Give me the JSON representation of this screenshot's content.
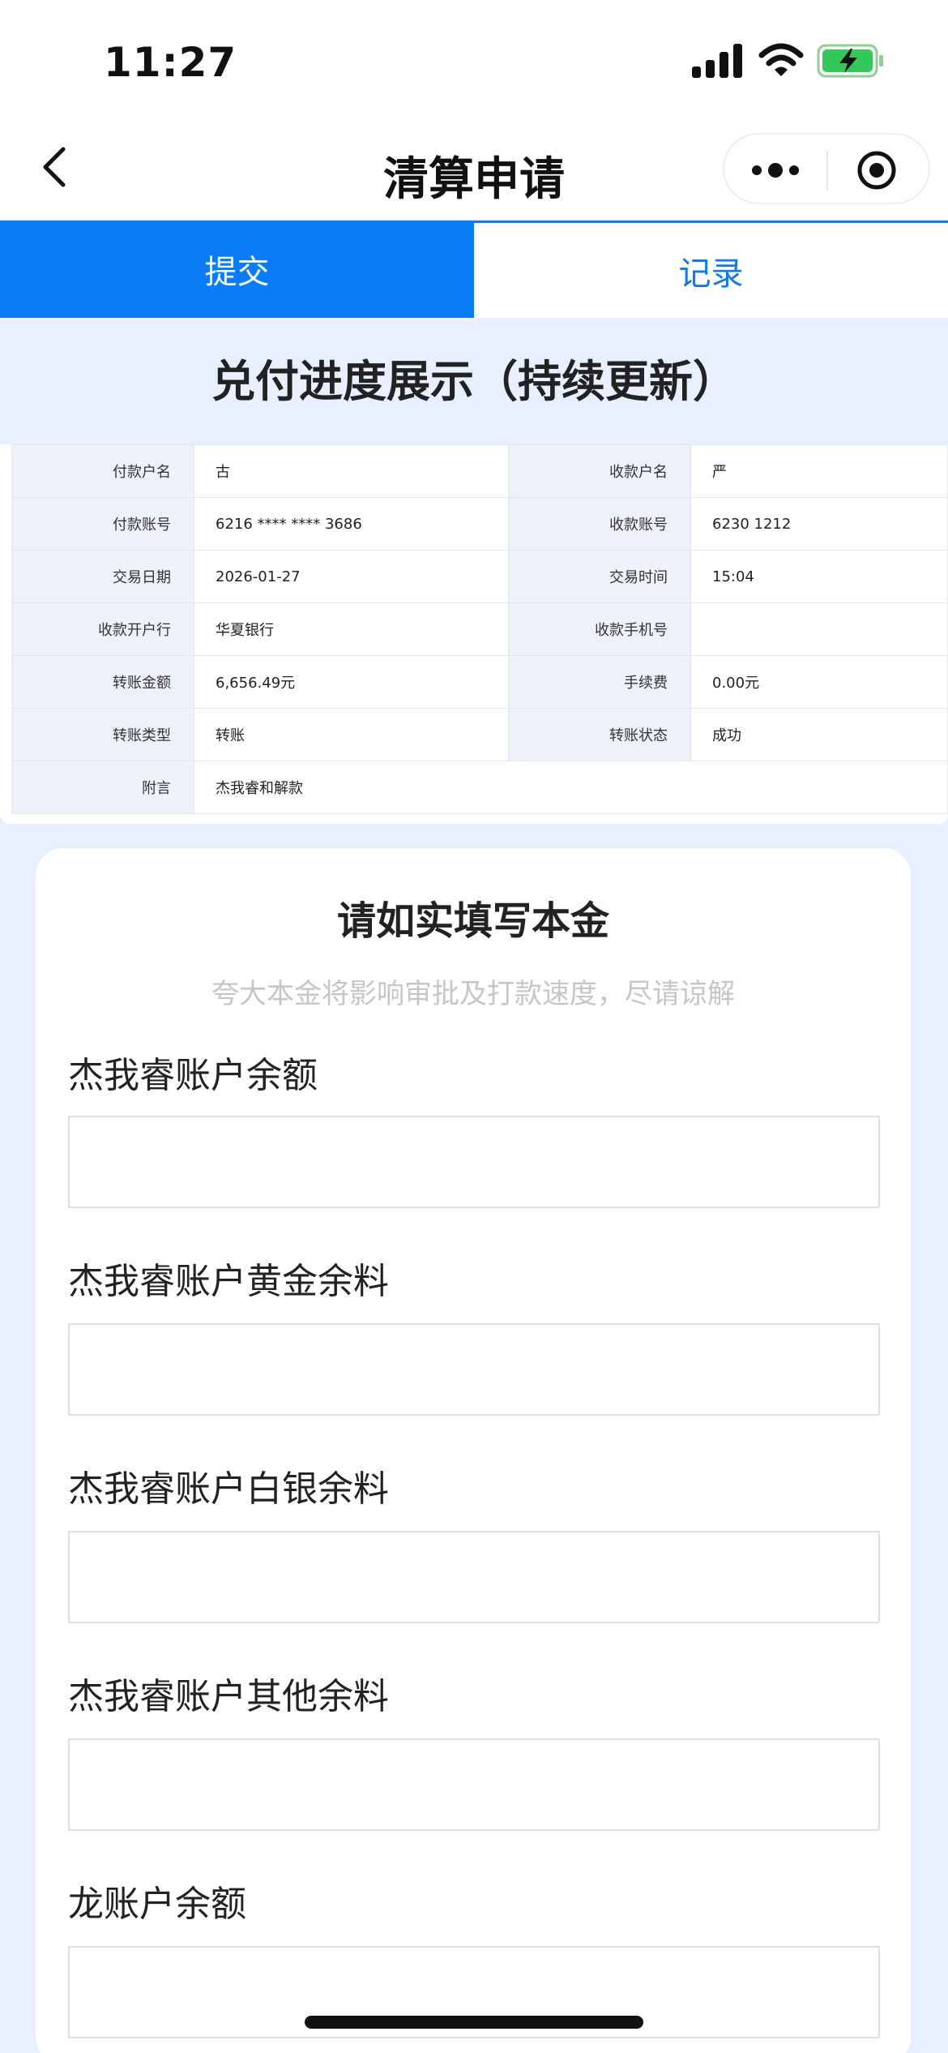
{
  "status_bar": {
    "time": "11:27",
    "icons": [
      "signal-icon",
      "wifi-icon",
      "battery-charging-icon"
    ],
    "battery_color": "#34c759"
  },
  "nav": {
    "title": "清算申请",
    "icons": [
      "back-icon",
      "more-icon",
      "target-icon"
    ]
  },
  "tabs": [
    {
      "label": "提交",
      "active": true
    },
    {
      "label": "记录",
      "active": false
    }
  ],
  "colors": {
    "accent": "#0a7cf6",
    "page_bg": "#e8efff",
    "placeholder": "#c6c6c6"
  },
  "section_title": "兑付进度展示（持续更新）",
  "receipt": {
    "rows": [
      {
        "l1": "付款户名",
        "v1": "古",
        "l2": "收款户名",
        "v2": "严"
      },
      {
        "l1": "付款账号",
        "v1": "6216 **** **** 3686",
        "l2": "收款账号",
        "v2": "6230 1212"
      },
      {
        "l1": "交易日期",
        "v1": "2026-01-27",
        "l2": "交易时间",
        "v2": "15:04"
      },
      {
        "l1": "收款开户行",
        "v1": "华夏银行",
        "l2": "收款手机号",
        "v2": ""
      },
      {
        "l1": "转账金额",
        "v1": "6,656.49元",
        "l2": "手续费",
        "v2": "0.00元"
      },
      {
        "l1": "转账类型",
        "v1": "转账",
        "l2": "转账状态",
        "v2": "成功"
      }
    ],
    "note_label": "附言",
    "note_value": "杰我睿和解款"
  },
  "form": {
    "title": "请如实填写本金",
    "subtitle": "夸大本金将影响审批及打款速度，尽请谅解",
    "fields": [
      {
        "label": "杰我睿账户余额",
        "value": ""
      },
      {
        "label": "杰我睿账户黄金余料",
        "value": ""
      },
      {
        "label": "杰我睿账户白银余料",
        "value": ""
      },
      {
        "label": "杰我睿账户其他余料",
        "value": ""
      },
      {
        "label": "龙账户余额",
        "value": ""
      }
    ]
  }
}
